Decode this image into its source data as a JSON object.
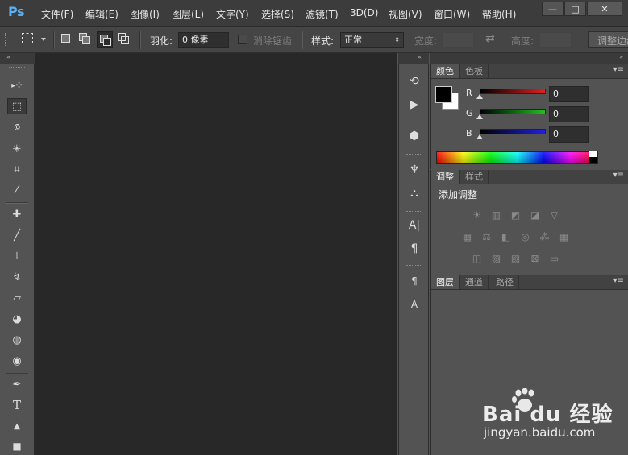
{
  "app": {
    "logo_text": "Ps"
  },
  "menu": [
    {
      "label": "文件(F)"
    },
    {
      "label": "编辑(E)"
    },
    {
      "label": "图像(I)"
    },
    {
      "label": "图层(L)"
    },
    {
      "label": "文字(Y)"
    },
    {
      "label": "选择(S)"
    },
    {
      "label": "滤镜(T)"
    },
    {
      "label": "3D(D)"
    },
    {
      "label": "视图(V)"
    },
    {
      "label": "窗口(W)"
    },
    {
      "label": "帮助(H)"
    }
  ],
  "window_controls": {
    "minimize": "—",
    "maximize": "□",
    "close": "✕"
  },
  "options_bar": {
    "feather_label": "羽化:",
    "feather_value": "0 像素",
    "antialias_label": "消除锯齿",
    "style_label": "样式:",
    "style_value": "正常",
    "width_label": "宽度:",
    "height_label": "高度:",
    "refine_edge_label": "调整边缘..."
  },
  "tools": [
    {
      "name": "move-tool-icon",
      "glyph": "▸✢"
    },
    {
      "name": "rectangular-marquee-tool-icon",
      "glyph": "⬚"
    },
    {
      "name": "lasso-tool-icon",
      "glyph": "⟃"
    },
    {
      "name": "magic-wand-tool-icon",
      "glyph": "✳"
    },
    {
      "name": "crop-tool-icon",
      "glyph": "⌗"
    },
    {
      "name": "eyedropper-tool-icon",
      "glyph": "⁄"
    },
    {
      "name": "healing-brush-tool-icon",
      "glyph": "✚"
    },
    {
      "name": "brush-tool-icon",
      "glyph": "╱"
    },
    {
      "name": "clone-stamp-tool-icon",
      "glyph": "⊥"
    },
    {
      "name": "history-brush-tool-icon",
      "glyph": "↯"
    },
    {
      "name": "eraser-tool-icon",
      "glyph": "▱"
    },
    {
      "name": "paint-bucket-tool-icon",
      "glyph": "◕"
    },
    {
      "name": "blur-tool-icon",
      "glyph": "◍"
    },
    {
      "name": "dodge-tool-icon",
      "glyph": "◉"
    },
    {
      "name": "pen-tool-icon",
      "glyph": "✒"
    },
    {
      "name": "type-tool-icon",
      "glyph": "T"
    },
    {
      "name": "path-selection-tool-icon",
      "glyph": "▲"
    },
    {
      "name": "rectangle-tool-icon",
      "glyph": "■"
    }
  ],
  "dock_icons": [
    {
      "name": "history-panel-icon",
      "glyph": "⟲"
    },
    {
      "name": "actions-panel-icon",
      "glyph": "▶"
    },
    {
      "name": "3d-panel-icon",
      "glyph": "⬢"
    },
    {
      "name": "brush-presets-icon",
      "glyph": "♆"
    },
    {
      "name": "brush-panel-icon",
      "glyph": "⛬"
    },
    {
      "name": "character-panel-icon",
      "glyph": "A|"
    },
    {
      "name": "paragraph-panel-icon",
      "glyph": "¶"
    },
    {
      "name": "paragraph-styles-icon",
      "glyph": "¶"
    },
    {
      "name": "character-styles-icon",
      "glyph": "A"
    }
  ],
  "color_panel": {
    "tabs": [
      "颜色",
      "色板"
    ],
    "channels": [
      {
        "label": "R",
        "value": "0",
        "color": "#e02020"
      },
      {
        "label": "G",
        "value": "0",
        "color": "#20c020"
      },
      {
        "label": "B",
        "value": "0",
        "color": "#2020e0"
      }
    ],
    "foreground": "#000000",
    "background": "#ffffff"
  },
  "adjustments_panel": {
    "tabs": [
      "调整",
      "样式"
    ],
    "heading": "添加调整",
    "rows": [
      [
        "brightness-contrast-icon",
        "levels-icon",
        "curves-icon",
        "exposure-icon",
        "vibrance-icon"
      ],
      [
        "hue-saturation-icon",
        "color-balance-icon",
        "black-white-icon",
        "photo-filter-icon",
        "channel-mixer-icon",
        "color-lookup-icon"
      ],
      [
        "invert-icon",
        "posterize-icon",
        "threshold-icon",
        "gradient-map-icon",
        "selective-color-icon"
      ]
    ]
  },
  "layers_panel": {
    "tabs": [
      "图层",
      "通道",
      "路径"
    ]
  },
  "watermark": {
    "brand": "Bai du 经验",
    "url": "jingyan.baidu.com"
  }
}
